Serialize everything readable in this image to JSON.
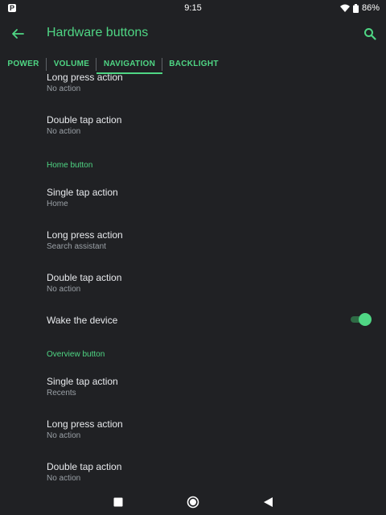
{
  "status_bar": {
    "left_icon": "P",
    "time": "9:15",
    "battery": "86%",
    "icons": [
      "wifi-icon",
      "battery-icon"
    ]
  },
  "app_bar": {
    "title": "Hardware buttons",
    "back_icon": "arrow-left-icon",
    "search_icon": "search-icon"
  },
  "tabs": [
    {
      "label": "POWER",
      "active": false
    },
    {
      "label": "VOLUME",
      "active": false
    },
    {
      "label": "NAVIGATION",
      "active": true
    },
    {
      "label": "BACKLIGHT",
      "active": false
    }
  ],
  "settings": {
    "partial_item": {
      "title": "Long press action",
      "sub": "No action"
    },
    "item_double_tap_1": {
      "title": "Double tap action",
      "sub": "No action"
    },
    "home_header": "Home button",
    "home_single_tap": {
      "title": "Single tap action",
      "sub": "Home"
    },
    "home_long_press": {
      "title": "Long press action",
      "sub": "Search assistant"
    },
    "home_double_tap": {
      "title": "Double tap action",
      "sub": "No action"
    },
    "wake_device": {
      "title": "Wake the device",
      "enabled": true
    },
    "overview_header": "Overview button",
    "overview_single_tap": {
      "title": "Single tap action",
      "sub": "Recents"
    },
    "overview_long_press": {
      "title": "Long press action",
      "sub": "No action"
    },
    "overview_double_tap": {
      "title": "Double tap action",
      "sub": "No action"
    }
  },
  "nav_bar": {
    "buttons": [
      "square-icon",
      "circle-icon",
      "triangle-back-icon"
    ]
  },
  "colors": {
    "accent": "#4fd684",
    "background": "#202124",
    "text_primary": "#e8eaed",
    "text_secondary": "#9aa0a6"
  }
}
